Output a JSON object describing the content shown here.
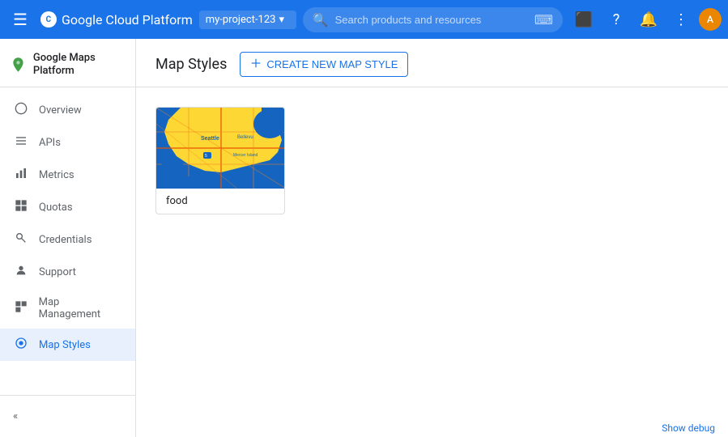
{
  "topnav": {
    "title": "Google Cloud Platform",
    "project_name": "my-project-123",
    "search_placeholder": "Search products and resources",
    "menu_icon": "☰",
    "search_icon": "🔍",
    "keyboard_icon": "⌨",
    "help_icon": "?",
    "notification_icon": "🔔",
    "more_icon": "⋮",
    "avatar_initials": "A"
  },
  "sidebar": {
    "product_name": "Google Maps Platform",
    "nav_items": [
      {
        "id": "overview",
        "label": "Overview",
        "icon": "○"
      },
      {
        "id": "apis",
        "label": "APIs",
        "icon": "≡"
      },
      {
        "id": "metrics",
        "label": "Metrics",
        "icon": "▦"
      },
      {
        "id": "quotas",
        "label": "Quotas",
        "icon": "▣"
      },
      {
        "id": "credentials",
        "label": "Credentials",
        "icon": "🔑"
      },
      {
        "id": "support",
        "label": "Support",
        "icon": "👤"
      },
      {
        "id": "map-management",
        "label": "Map Management",
        "icon": "▣"
      },
      {
        "id": "map-styles",
        "label": "Map Styles",
        "icon": "◎",
        "active": true
      }
    ],
    "collapse_label": "«"
  },
  "main": {
    "page_title": "Map Styles",
    "create_button_label": "CREATE NEW MAP STYLE",
    "create_button_icon": "+"
  },
  "map_styles": {
    "cards": [
      {
        "id": "food",
        "label": "food"
      }
    ]
  },
  "bottom": {
    "debug_label": "Show debug"
  }
}
